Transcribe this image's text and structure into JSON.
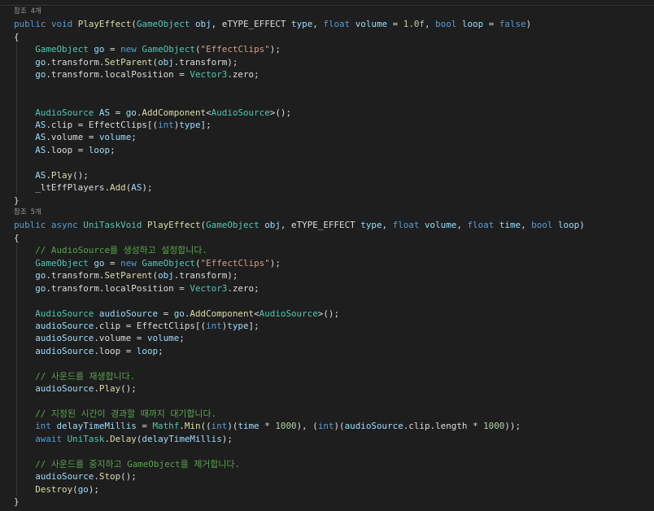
{
  "editor": {
    "lines": [
      {
        "lens": "참조 4개"
      },
      {
        "tokens": [
          [
            "kw",
            "public"
          ],
          [
            "tx",
            " "
          ],
          [
            "kw",
            "void"
          ],
          [
            "tx",
            " "
          ],
          [
            "fn",
            "PlayEffect"
          ],
          [
            "tx",
            "("
          ],
          [
            "ty",
            "GameObject"
          ],
          [
            "tx",
            " "
          ],
          [
            "pa",
            "obj"
          ],
          [
            "tx",
            ", "
          ],
          [
            "tx",
            "eTYPE_EFFECT"
          ],
          [
            "tx",
            " "
          ],
          [
            "pa",
            "type"
          ],
          [
            "tx",
            ", "
          ],
          [
            "kw",
            "float"
          ],
          [
            "tx",
            " "
          ],
          [
            "pa",
            "volume"
          ],
          [
            "tx",
            " = "
          ],
          [
            "nu",
            "1.0f"
          ],
          [
            "tx",
            ", "
          ],
          [
            "kw",
            "bool"
          ],
          [
            "tx",
            " "
          ],
          [
            "pa",
            "loop"
          ],
          [
            "tx",
            " = "
          ],
          [
            "kw",
            "false"
          ],
          [
            "tx",
            ")"
          ]
        ]
      },
      {
        "tokens": [
          [
            "tx",
            "{"
          ]
        ]
      },
      {
        "guides": 1,
        "tokens": [
          [
            "tx",
            "    "
          ],
          [
            "ty",
            "GameObject"
          ],
          [
            "tx",
            " "
          ],
          [
            "lv",
            "go"
          ],
          [
            "tx",
            " = "
          ],
          [
            "kw",
            "new"
          ],
          [
            "tx",
            " "
          ],
          [
            "ty",
            "GameObject"
          ],
          [
            "tx",
            "("
          ],
          [
            "st",
            "\"EffectClips\""
          ],
          [
            "tx",
            ");"
          ]
        ]
      },
      {
        "guides": 1,
        "tokens": [
          [
            "tx",
            "    "
          ],
          [
            "lv",
            "go"
          ],
          [
            "tx",
            ".transform."
          ],
          [
            "fn",
            "SetParent"
          ],
          [
            "tx",
            "("
          ],
          [
            "pa",
            "obj"
          ],
          [
            "tx",
            ".transform);"
          ]
        ]
      },
      {
        "guides": 1,
        "tokens": [
          [
            "tx",
            "    "
          ],
          [
            "lv",
            "go"
          ],
          [
            "tx",
            ".transform.localPosition = "
          ],
          [
            "ty",
            "Vector3"
          ],
          [
            "tx",
            ".zero;"
          ]
        ]
      },
      {
        "guides": 1,
        "tokens": []
      },
      {
        "guides": 1,
        "tokens": []
      },
      {
        "guides": 1,
        "tokens": [
          [
            "tx",
            "    "
          ],
          [
            "ty",
            "AudioSource"
          ],
          [
            "tx",
            " "
          ],
          [
            "lv",
            "AS"
          ],
          [
            "tx",
            " = "
          ],
          [
            "lv",
            "go"
          ],
          [
            "tx",
            "."
          ],
          [
            "fn",
            "AddComponent"
          ],
          [
            "tx",
            "<"
          ],
          [
            "ty",
            "AudioSource"
          ],
          [
            "tx",
            ">();"
          ]
        ]
      },
      {
        "guides": 1,
        "tokens": [
          [
            "tx",
            "    "
          ],
          [
            "lv",
            "AS"
          ],
          [
            "tx",
            ".clip = EffectClips[("
          ],
          [
            "kw",
            "int"
          ],
          [
            "tx",
            ")"
          ],
          [
            "pa",
            "type"
          ],
          [
            "tx",
            "];"
          ]
        ]
      },
      {
        "guides": 1,
        "tokens": [
          [
            "tx",
            "    "
          ],
          [
            "lv",
            "AS"
          ],
          [
            "tx",
            ".volume = "
          ],
          [
            "pa",
            "volume"
          ],
          [
            "tx",
            ";"
          ]
        ]
      },
      {
        "guides": 1,
        "tokens": [
          [
            "tx",
            "    "
          ],
          [
            "lv",
            "AS"
          ],
          [
            "tx",
            ".loop = "
          ],
          [
            "pa",
            "loop"
          ],
          [
            "tx",
            ";"
          ]
        ]
      },
      {
        "guides": 1,
        "tokens": []
      },
      {
        "guides": 1,
        "tokens": [
          [
            "tx",
            "    "
          ],
          [
            "lv",
            "AS"
          ],
          [
            "tx",
            "."
          ],
          [
            "fn",
            "Play"
          ],
          [
            "tx",
            "();"
          ]
        ]
      },
      {
        "guides": 1,
        "tokens": [
          [
            "tx",
            "    _ltEffPlayers."
          ],
          [
            "fn",
            "Add"
          ],
          [
            "tx",
            "("
          ],
          [
            "lv",
            "AS"
          ],
          [
            "tx",
            ");"
          ]
        ]
      },
      {
        "tokens": [
          [
            "tx",
            "}"
          ]
        ]
      },
      {
        "lens": "참조 5개"
      },
      {
        "tokens": [
          [
            "kw",
            "public"
          ],
          [
            "tx",
            " "
          ],
          [
            "kw",
            "async"
          ],
          [
            "tx",
            " "
          ],
          [
            "ty",
            "UniTaskVoid"
          ],
          [
            "tx",
            " "
          ],
          [
            "fn",
            "PlayEffect"
          ],
          [
            "tx",
            "("
          ],
          [
            "ty",
            "GameObject"
          ],
          [
            "tx",
            " "
          ],
          [
            "pa",
            "obj"
          ],
          [
            "tx",
            ", "
          ],
          [
            "tx",
            "eTYPE_EFFECT"
          ],
          [
            "tx",
            " "
          ],
          [
            "pa",
            "type"
          ],
          [
            "tx",
            ", "
          ],
          [
            "kw",
            "float"
          ],
          [
            "tx",
            " "
          ],
          [
            "pa",
            "volume"
          ],
          [
            "tx",
            ", "
          ],
          [
            "kw",
            "float"
          ],
          [
            "tx",
            " "
          ],
          [
            "pa",
            "time"
          ],
          [
            "tx",
            ", "
          ],
          [
            "kw",
            "bool"
          ],
          [
            "tx",
            " "
          ],
          [
            "pa",
            "loop"
          ],
          [
            "tx",
            ")"
          ]
        ]
      },
      {
        "tokens": [
          [
            "tx",
            "{"
          ]
        ]
      },
      {
        "guides": 1,
        "tokens": [
          [
            "tx",
            "    "
          ],
          [
            "cm",
            "// AudioSource를 생성하고 설정합니다."
          ]
        ]
      },
      {
        "guides": 1,
        "tokens": [
          [
            "tx",
            "    "
          ],
          [
            "ty",
            "GameObject"
          ],
          [
            "tx",
            " "
          ],
          [
            "lv",
            "go"
          ],
          [
            "tx",
            " = "
          ],
          [
            "kw",
            "new"
          ],
          [
            "tx",
            " "
          ],
          [
            "ty",
            "GameObject"
          ],
          [
            "tx",
            "("
          ],
          [
            "st",
            "\"EffectClips\""
          ],
          [
            "tx",
            ");"
          ]
        ]
      },
      {
        "guides": 1,
        "tokens": [
          [
            "tx",
            "    "
          ],
          [
            "lv",
            "go"
          ],
          [
            "tx",
            ".transform."
          ],
          [
            "fn",
            "SetParent"
          ],
          [
            "tx",
            "("
          ],
          [
            "pa",
            "obj"
          ],
          [
            "tx",
            ".transform);"
          ]
        ]
      },
      {
        "guides": 1,
        "tokens": [
          [
            "tx",
            "    "
          ],
          [
            "lv",
            "go"
          ],
          [
            "tx",
            ".transform.localPosition = "
          ],
          [
            "ty",
            "Vector3"
          ],
          [
            "tx",
            ".zero;"
          ]
        ]
      },
      {
        "guides": 1,
        "tokens": []
      },
      {
        "guides": 1,
        "tokens": [
          [
            "tx",
            "    "
          ],
          [
            "ty",
            "AudioSource"
          ],
          [
            "tx",
            " "
          ],
          [
            "lv",
            "audioSource"
          ],
          [
            "tx",
            " = "
          ],
          [
            "lv",
            "go"
          ],
          [
            "tx",
            "."
          ],
          [
            "fn",
            "AddComponent"
          ],
          [
            "tx",
            "<"
          ],
          [
            "ty",
            "AudioSource"
          ],
          [
            "tx",
            ">();"
          ]
        ]
      },
      {
        "guides": 1,
        "tokens": [
          [
            "tx",
            "    "
          ],
          [
            "lv",
            "audioSource"
          ],
          [
            "tx",
            ".clip = EffectClips[("
          ],
          [
            "kw",
            "int"
          ],
          [
            "tx",
            ")"
          ],
          [
            "pa",
            "type"
          ],
          [
            "tx",
            "];"
          ]
        ]
      },
      {
        "guides": 1,
        "tokens": [
          [
            "tx",
            "    "
          ],
          [
            "lv",
            "audioSource"
          ],
          [
            "tx",
            ".volume = "
          ],
          [
            "pa",
            "volume"
          ],
          [
            "tx",
            ";"
          ]
        ]
      },
      {
        "guides": 1,
        "tokens": [
          [
            "tx",
            "    "
          ],
          [
            "lv",
            "audioSource"
          ],
          [
            "tx",
            ".loop = "
          ],
          [
            "pa",
            "loop"
          ],
          [
            "tx",
            ";"
          ]
        ]
      },
      {
        "guides": 1,
        "tokens": []
      },
      {
        "guides": 1,
        "tokens": [
          [
            "tx",
            "    "
          ],
          [
            "cm",
            "// 사운드를 재생합니다."
          ]
        ]
      },
      {
        "guides": 1,
        "tokens": [
          [
            "tx",
            "    "
          ],
          [
            "lv",
            "audioSource"
          ],
          [
            "tx",
            "."
          ],
          [
            "fn",
            "Play"
          ],
          [
            "tx",
            "();"
          ]
        ]
      },
      {
        "guides": 1,
        "tokens": []
      },
      {
        "guides": 1,
        "tokens": [
          [
            "tx",
            "    "
          ],
          [
            "cm",
            "// 지정된 시간이 경과할 때까지 대기합니다."
          ]
        ]
      },
      {
        "guides": 1,
        "tokens": [
          [
            "tx",
            "    "
          ],
          [
            "kw",
            "int"
          ],
          [
            "tx",
            " "
          ],
          [
            "lv",
            "delayTimeMillis"
          ],
          [
            "tx",
            " = "
          ],
          [
            "ty",
            "Mathf"
          ],
          [
            "tx",
            "."
          ],
          [
            "fn",
            "Min"
          ],
          [
            "tx",
            "(("
          ],
          [
            "kw",
            "int"
          ],
          [
            "tx",
            ")("
          ],
          [
            "pa",
            "time"
          ],
          [
            "tx",
            " * "
          ],
          [
            "nu",
            "1000"
          ],
          [
            "tx",
            "), ("
          ],
          [
            "kw",
            "int"
          ],
          [
            "tx",
            ")("
          ],
          [
            "lv",
            "audioSource"
          ],
          [
            "tx",
            ".clip.length * "
          ],
          [
            "nu",
            "1000"
          ],
          [
            "tx",
            "));"
          ]
        ]
      },
      {
        "guides": 1,
        "tokens": [
          [
            "tx",
            "    "
          ],
          [
            "kw",
            "await"
          ],
          [
            "tx",
            " "
          ],
          [
            "ty",
            "UniTask"
          ],
          [
            "tx",
            "."
          ],
          [
            "fn",
            "Delay"
          ],
          [
            "tx",
            "("
          ],
          [
            "lv",
            "delayTimeMillis"
          ],
          [
            "tx",
            ");"
          ]
        ]
      },
      {
        "guides": 1,
        "tokens": []
      },
      {
        "guides": 1,
        "tokens": [
          [
            "tx",
            "    "
          ],
          [
            "cm",
            "// 사운드를 중지하고 GameObject를 제거합니다."
          ]
        ]
      },
      {
        "guides": 1,
        "tokens": [
          [
            "tx",
            "    "
          ],
          [
            "lv",
            "audioSource"
          ],
          [
            "tx",
            "."
          ],
          [
            "fn",
            "Stop"
          ],
          [
            "tx",
            "();"
          ]
        ]
      },
      {
        "guides": 1,
        "tokens": [
          [
            "tx",
            "    "
          ],
          [
            "fn",
            "Destroy"
          ],
          [
            "tx",
            "("
          ],
          [
            "lv",
            "go"
          ],
          [
            "tx",
            ");"
          ]
        ]
      },
      {
        "tokens": [
          [
            "tx",
            "}"
          ]
        ]
      }
    ]
  }
}
